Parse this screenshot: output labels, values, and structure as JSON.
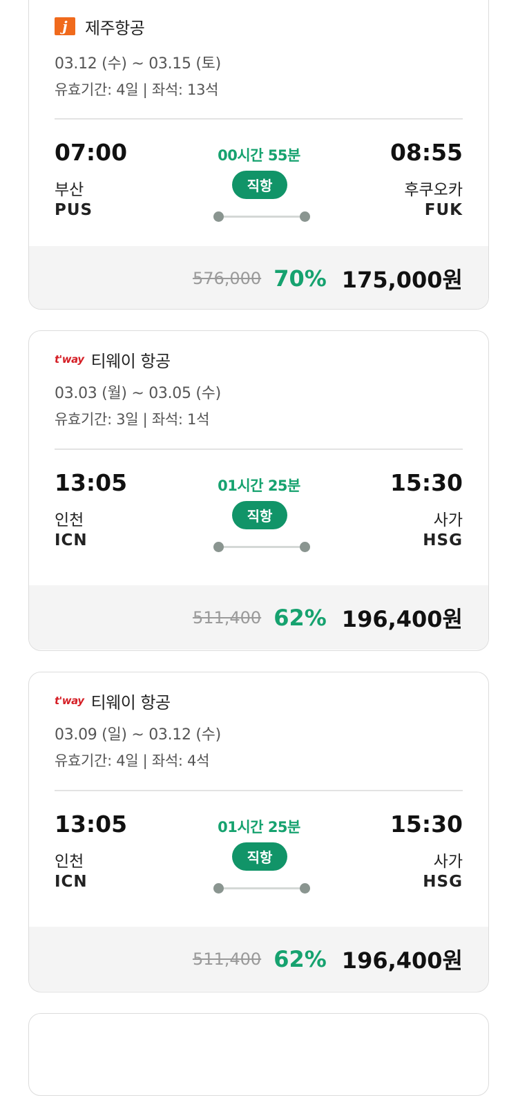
{
  "flights": [
    {
      "airline": "제주항공",
      "logo": "jeju-air-logo",
      "dates": "03.12 (수) ~ 03.15 (토)",
      "validity": "유효기간: 4일 | 좌석: 13석",
      "dep_time": "07:00",
      "dep_city": "부산",
      "dep_code": "PUS",
      "duration": "00시간 55분",
      "direct_label": "직항",
      "arr_time": "08:55",
      "arr_city": "후쿠오카",
      "arr_code": "FUK",
      "original_price": "576,000",
      "discount": "70%",
      "final_price": "175,000원"
    },
    {
      "airline": "티웨이 항공",
      "logo": "tway-logo",
      "dates": "03.03 (월) ~ 03.05 (수)",
      "validity": "유효기간: 3일 | 좌석: 1석",
      "dep_time": "13:05",
      "dep_city": "인천",
      "dep_code": "ICN",
      "duration": "01시간 25분",
      "direct_label": "직항",
      "arr_time": "15:30",
      "arr_city": "사가",
      "arr_code": "HSG",
      "original_price": "511,400",
      "discount": "62%",
      "final_price": "196,400원"
    },
    {
      "airline": "티웨이 항공",
      "logo": "tway-logo",
      "dates": "03.09 (일) ~ 03.12 (수)",
      "validity": "유효기간: 4일 | 좌석: 4석",
      "dep_time": "13:05",
      "dep_city": "인천",
      "dep_code": "ICN",
      "duration": "01시간 25분",
      "direct_label": "직항",
      "arr_time": "15:30",
      "arr_city": "사가",
      "arr_code": "HSG",
      "original_price": "511,400",
      "discount": "62%",
      "final_price": "196,400원"
    }
  ],
  "logos": {
    "jeju_letter": "j",
    "tway_text": "t'way"
  },
  "colors": {
    "accent_green": "#16a26f",
    "pill_green": "#119468",
    "jeju_orange": "#f06a1c",
    "tway_red": "#d51f26"
  }
}
